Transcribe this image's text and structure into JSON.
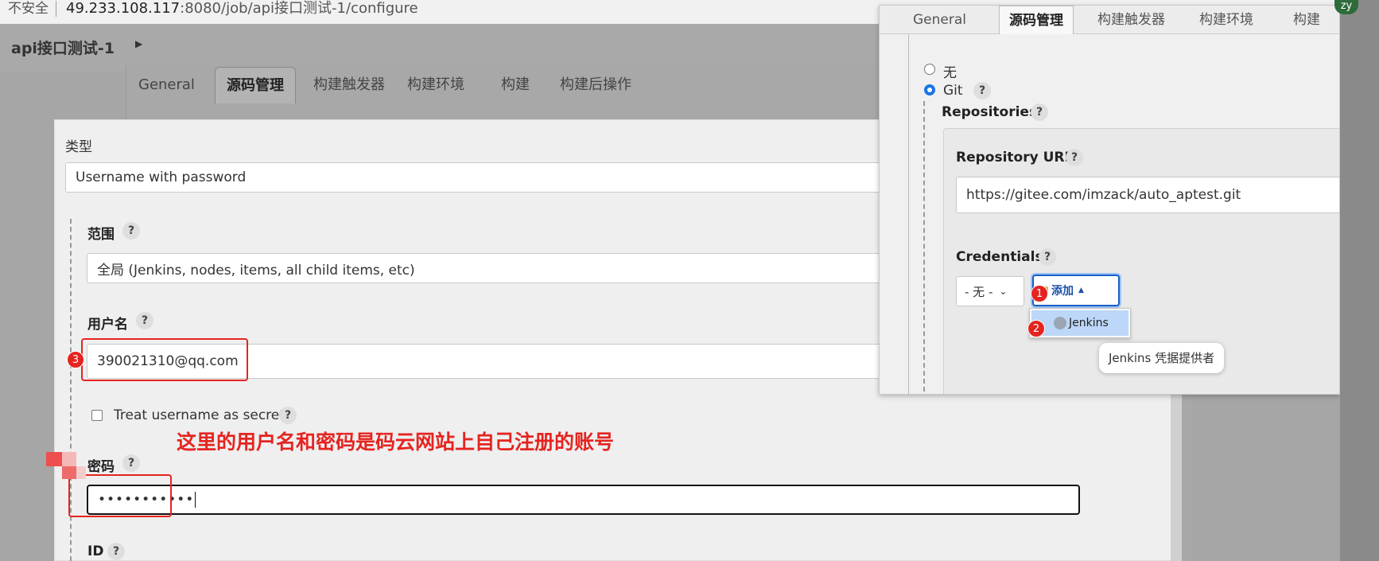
{
  "browser": {
    "security_label": "不安全",
    "url_host": "49.233.108.117",
    "url_path": ":8080/job/api接口测试-1/configure",
    "profile_initials": "zy"
  },
  "job": {
    "title": "api接口测试-1"
  },
  "bg_tabs": [
    "General",
    "源码管理",
    "构建触发器",
    "构建环境",
    "构建",
    "构建后操作"
  ],
  "dialog": {
    "type_label": "类型",
    "type_value": "Username with password",
    "scope_label": "范围",
    "scope_value": "全局 (Jenkins, nodes, items, all child items, etc)",
    "username_label": "用户名",
    "username_value": "390021310@qq.com",
    "treat_secret_label": "Treat username as secret",
    "password_label": "密码",
    "password_value": "•••••••••••",
    "id_label": "ID",
    "help": "?"
  },
  "annotations": {
    "note": "这里的用户名和密码是码云网站上自己注册的账号",
    "badge1": "1",
    "badge2": "2",
    "badge3": "3"
  },
  "popup": {
    "tabs": [
      "General",
      "源码管理",
      "构建触发器",
      "构建环境",
      "构建"
    ],
    "scm_none": "无",
    "scm_git": "Git",
    "repositories_label": "Repositories",
    "repo_url_label": "Repository URL",
    "repo_url_value": "https://gitee.com/imzack/auto_aptest.git",
    "credentials_label": "Credentials",
    "credentials_select": "- 无 -",
    "add_button": "添加",
    "menu_jenkins": "Jenkins",
    "tooltip": "Jenkins 凭据提供者",
    "help": "?"
  },
  "colors": {
    "annotation_red": "#e52420",
    "focus_blue": "#1a5fc4",
    "menu_highlight": "#bcd7f7"
  }
}
